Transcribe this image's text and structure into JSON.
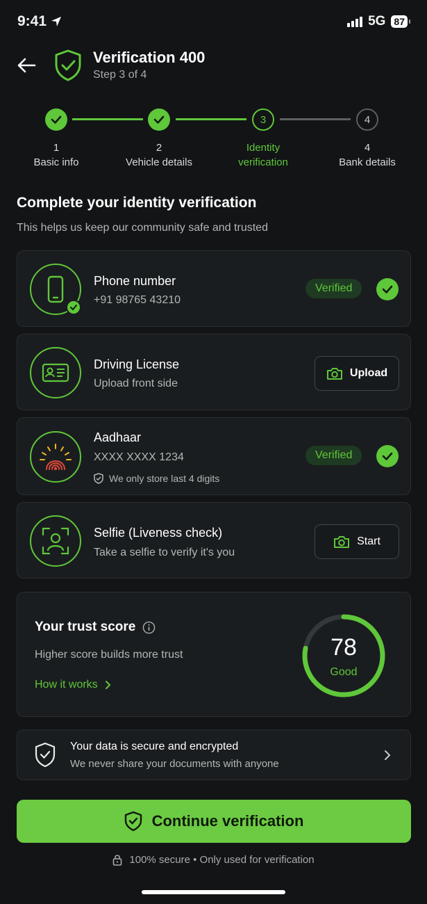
{
  "status_bar": {
    "time": "9:41",
    "network": "5G",
    "battery": "87"
  },
  "header": {
    "title": "Verification 400",
    "subtitle": "Step 3 of 4"
  },
  "stepper": [
    {
      "number": "1",
      "label": "Basic info",
      "state": "done"
    },
    {
      "number": "2",
      "label": "Vehicle details",
      "state": "done"
    },
    {
      "number": "3",
      "label": "Identity verification",
      "state": "active"
    },
    {
      "number": "4",
      "label": "Bank details",
      "state": "todo"
    }
  ],
  "section": {
    "title": "Complete your identity verification",
    "subtitle": "This helps us keep our community safe and trusted"
  },
  "items": {
    "phone": {
      "title": "Phone number",
      "value": "+91 98765 43210",
      "badge": "Verified",
      "icon": "phone-icon"
    },
    "license": {
      "title": "Driving License",
      "value": "Upload front side",
      "action": "Upload",
      "icon": "id-card-icon"
    },
    "aadhaar": {
      "title": "Aadhaar",
      "value": "XXXX XXXX 1234",
      "note": "We only store last 4 digits",
      "badge": "Verified",
      "icon": "aadhaar-fingerprint-icon"
    },
    "selfie": {
      "title": "Selfie (Liveness check)",
      "value": "Take a selfie to verify it's you",
      "action": "Start",
      "icon": "face-scan-icon"
    }
  },
  "trust": {
    "title": "Your trust score",
    "subtitle": "Higher score builds more trust",
    "link": "How it works",
    "score": "78",
    "score_label": "Good",
    "score_fraction": 0.78
  },
  "security": {
    "title": "Your data is secure and encrypted",
    "subtitle": "We never share your documents with anyone"
  },
  "cta": {
    "label": "Continue verification"
  },
  "footer": {
    "text": "100% secure • Only used for verification"
  },
  "colors": {
    "accent": "#5fc73a",
    "background": "#121416",
    "card": "#1a1d1f",
    "verified_badge_bg": "#1f3a22"
  }
}
